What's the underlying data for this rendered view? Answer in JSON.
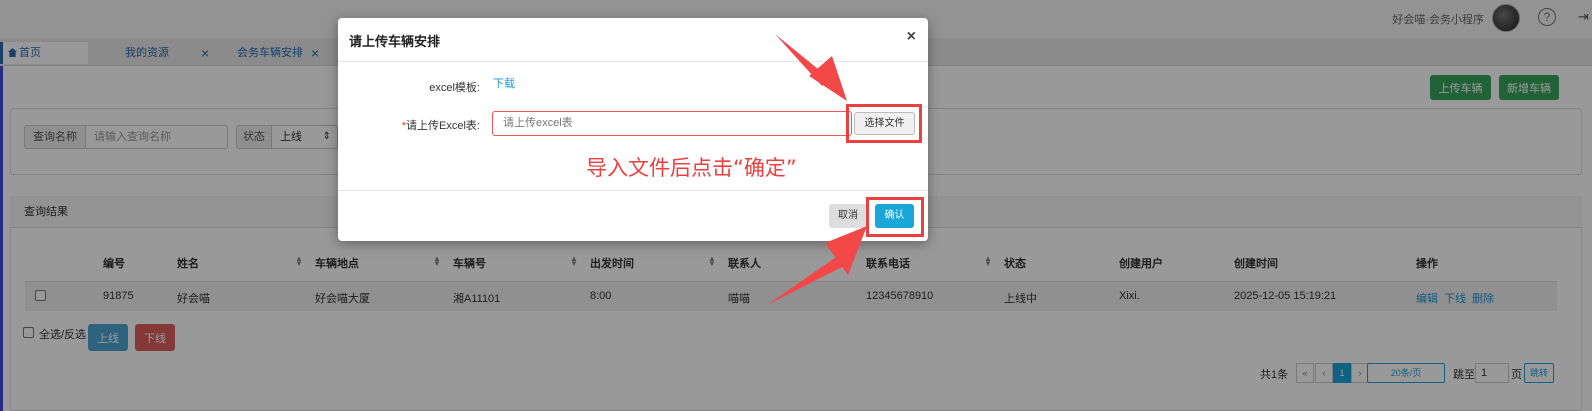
{
  "topbar": {
    "user_text": "好会喵·会务小程序",
    "help": "?",
    "exit": "⇥"
  },
  "tabs": [
    {
      "label": "首页"
    },
    {
      "label": "我的资源",
      "close": "×"
    },
    {
      "label": "会务车辆安排",
      "close": "×"
    }
  ],
  "actions": {
    "upload_label": "上传车辆",
    "add_label": "新增车辆"
  },
  "search": {
    "name_label": "查询名称",
    "name_placeholder": "请输入查询名称",
    "status_label": "状态",
    "status_value": "上线",
    "status_arrow": "⇕"
  },
  "results": {
    "title": "查询结果",
    "columns": [
      "编号",
      "姓名",
      "车辆地点",
      "车辆号",
      "出发时间",
      "联系人",
      "联系电话",
      "状态",
      "创建用户",
      "创建时间",
      "操作"
    ],
    "row": {
      "id": "91875",
      "name": "好会喵",
      "location": "好会喵大厦",
      "plate": "湘A11101",
      "time": "8:00",
      "contact": "喵喵",
      "phone": "12345678910",
      "status": "上线中",
      "creator": "Xixi.",
      "created_at": "2025-12-05 15:19:21",
      "op_edit": "编辑",
      "op_offline": "下线",
      "op_delete": "删除"
    },
    "select_all": "全选/反选",
    "online_btn": "上线",
    "offline_btn": "下线"
  },
  "pagination": {
    "total": "共1条",
    "first": "«",
    "prev": "‹",
    "page": "1",
    "next": "›",
    "last": "»",
    "page_size": "20条/页",
    "jump_to": "跳至",
    "jump_value": "1",
    "page_unit": "页",
    "jump_btn": "跳转"
  },
  "modal": {
    "title": "请上传车辆安排",
    "close": "×",
    "template_label": "excel模板:",
    "template_link": "下载",
    "required_mark": "*",
    "upload_label": "请上传Excel表:",
    "upload_placeholder": "请上传excel表",
    "choose_file": "选择文件",
    "annotation": "导入文件后点击“确定”",
    "cancel": "取消",
    "confirm": "确认"
  },
  "colors": {
    "accent": "#1aa6d9",
    "green": "#3aa35f",
    "danger": "#dc5e5e",
    "annotation": "#e94040"
  }
}
